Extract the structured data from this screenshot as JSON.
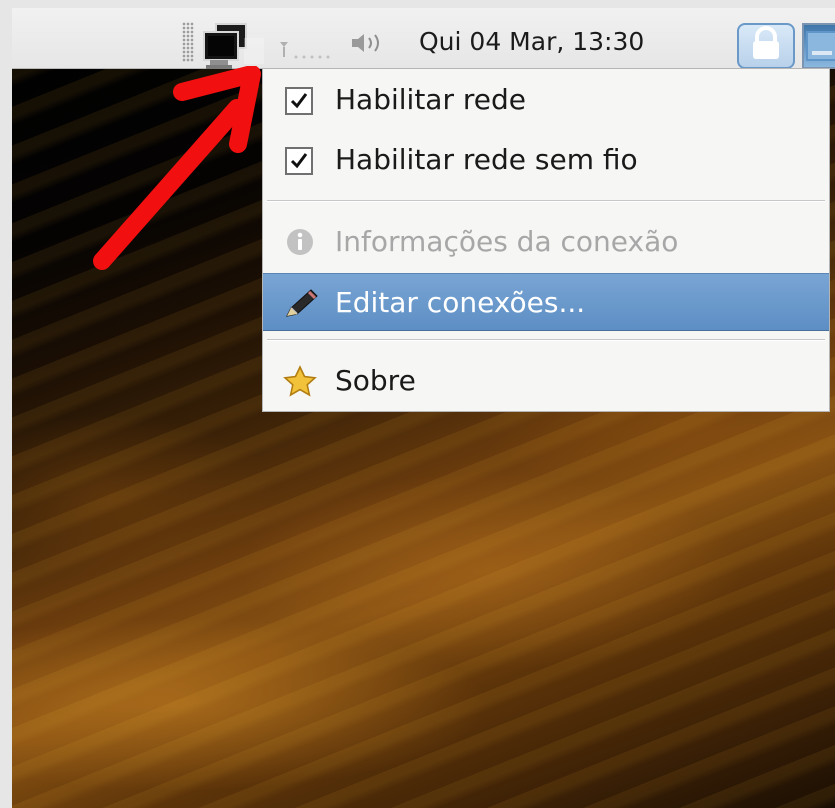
{
  "panel": {
    "clock": "Qui 04 Mar, 13:30"
  },
  "menu": {
    "items": [
      {
        "label": "Habilitar rede",
        "checked": true,
        "icon": "checkbox-icon"
      },
      {
        "label": "Habilitar rede sem fio",
        "checked": true,
        "icon": "checkbox-icon"
      },
      {
        "label": "Informações da conexão",
        "disabled": true,
        "icon": "info-icon"
      },
      {
        "label": "Editar conexões...",
        "selected": true,
        "icon": "pencil-icon"
      },
      {
        "label": "Sobre",
        "icon": "star-icon"
      }
    ]
  },
  "colors": {
    "menu_highlight": "#6695c9",
    "annotation_arrow": "#f20f0f",
    "panel_background": "#ececec"
  }
}
